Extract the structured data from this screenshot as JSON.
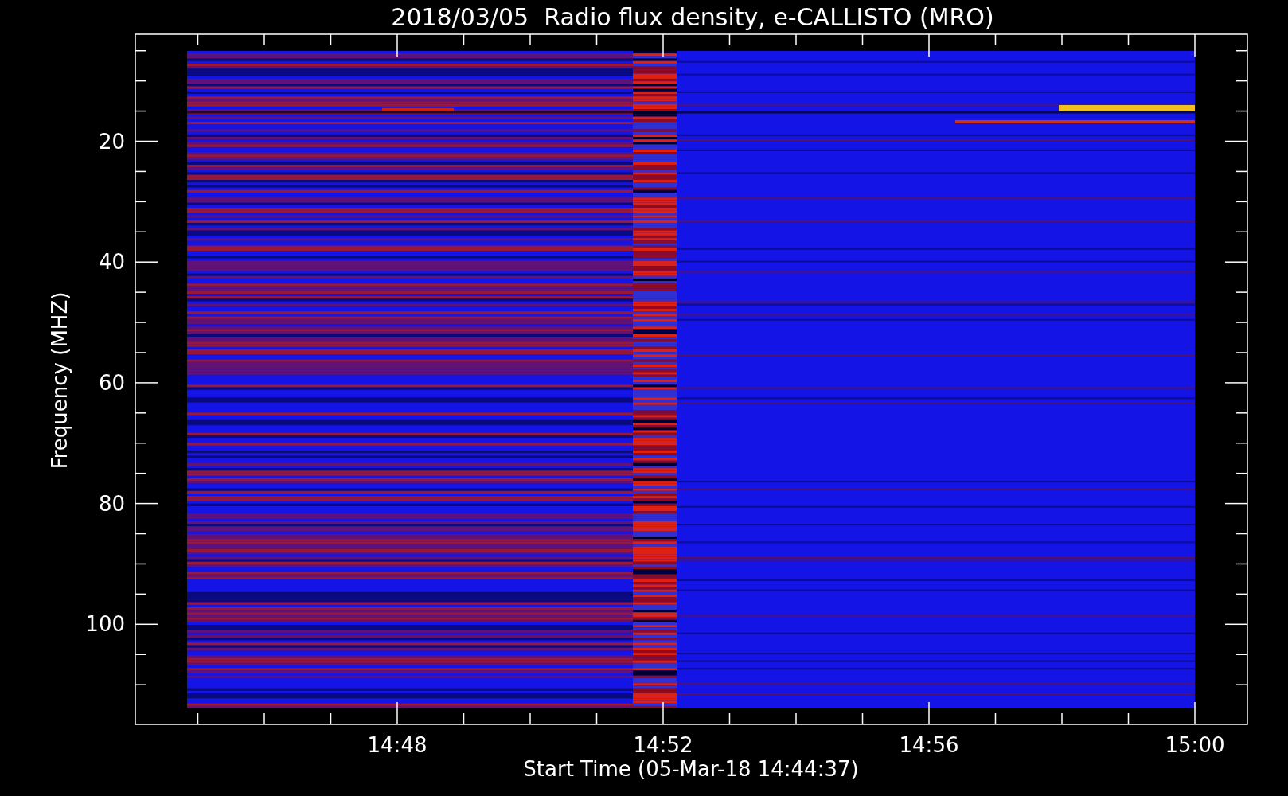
{
  "title": "2018/03/05  Radio flux density, e-CALLISTO (MRO)",
  "plot": {
    "ylabel": "Frequency (MHZ)",
    "xlabel": "Start Time (05-Mar-18 14:44:37)",
    "y_tick_labels": [
      "20",
      "40",
      "60",
      "80",
      "100"
    ],
    "x_tick_labels": [
      "14:48",
      "14:52",
      "14:56",
      "15:00"
    ]
  }
}
